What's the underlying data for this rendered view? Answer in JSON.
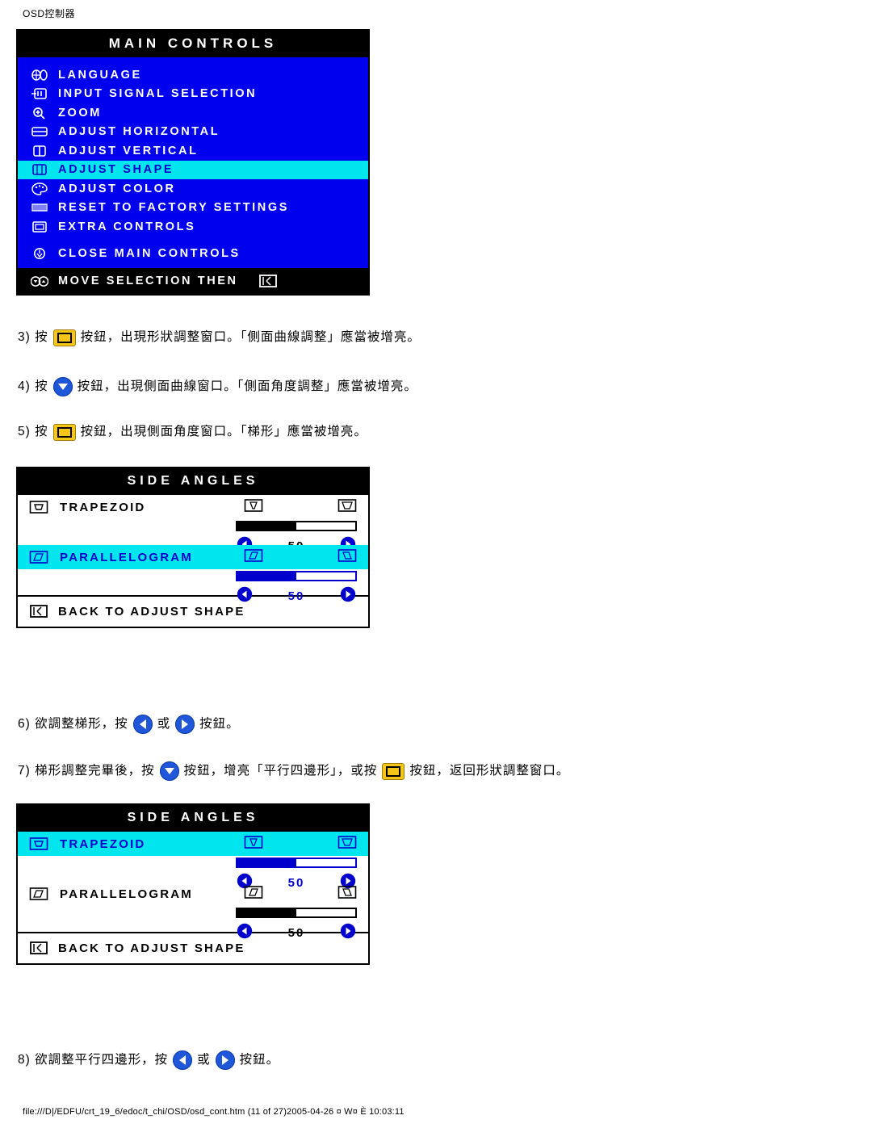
{
  "header": {
    "title": "OSD控制器"
  },
  "footer": {
    "text": "file:///D|/EDFU/crt_19_6/edoc/t_chi/OSD/osd_cont.htm (11 of 27)2005-04-26 ¤ W¤ È  10:03:11"
  },
  "main_controls": {
    "title": "MAIN CONTROLS",
    "items": [
      {
        "label": "LANGUAGE",
        "icon": "globe-icon",
        "highlighted": false
      },
      {
        "label": "INPUT SIGNAL SELECTION",
        "icon": "input-signal-icon",
        "highlighted": false
      },
      {
        "label": "ZOOM",
        "icon": "magnifier-icon",
        "highlighted": false
      },
      {
        "label": "ADJUST HORIZONTAL",
        "icon": "horizontal-icon",
        "highlighted": false
      },
      {
        "label": "ADJUST VERTICAL",
        "icon": "vertical-icon",
        "highlighted": false
      },
      {
        "label": "ADJUST SHAPE",
        "icon": "shape-icon",
        "highlighted": true
      },
      {
        "label": "ADJUST COLOR",
        "icon": "palette-icon",
        "highlighted": false
      },
      {
        "label": "RESET TO FACTORY SETTINGS",
        "icon": "reset-icon",
        "highlighted": false
      },
      {
        "label": "EXTRA CONTROLS",
        "icon": "extra-controls-icon",
        "highlighted": false
      },
      {
        "label": "CLOSE MAIN CONTROLS",
        "icon": "close-icon",
        "highlighted": false
      }
    ],
    "footer_label": "MOVE SELECTION THEN"
  },
  "side_angles_1": {
    "title": "SIDE ANGLES",
    "items": [
      {
        "label": "TRAPEZOID",
        "icon": "trapezoid-icon",
        "highlighted": false,
        "value": "50",
        "fill_percent": 50
      },
      {
        "label": "PARALLELOGRAM",
        "icon": "parallelogram-icon",
        "highlighted": true,
        "value": "50",
        "fill_percent": 50
      }
    ],
    "footer_label": "BACK TO ADJUST SHAPE"
  },
  "side_angles_2": {
    "title": "SIDE ANGLES",
    "items": [
      {
        "label": "TRAPEZOID",
        "icon": "trapezoid-icon",
        "highlighted": true,
        "value": "50",
        "fill_percent": 50
      },
      {
        "label": "PARALLELOGRAM",
        "icon": "parallelogram-icon",
        "highlighted": false,
        "value": "50",
        "fill_percent": 50
      }
    ],
    "footer_label": "BACK TO ADJUST SHAPE"
  },
  "steps": {
    "s3a": "3) 按",
    "s3b": "按鈕，出現形狀調整窗口。「側面曲線調整」應當被增亮。",
    "s4a": "4) 按",
    "s4b": "按鈕，出現側面曲線窗口。「側面角度調整」應當被增亮。",
    "s5a": "5) 按",
    "s5b": "按鈕，出現側面角度窗口。「梯形」應當被增亮。",
    "s6a": "6) 欲調整梯形，按",
    "s6b": "或",
    "s6c": "按鈕。",
    "s7a": "7) 梯形調整完畢後，按",
    "s7b": "按鈕，增亮「平行四邊形」，或按",
    "s7c": "按鈕，返回形狀調整窗口。",
    "s8a": "8) 欲調整平行四邊形，按",
    "s8b": "或",
    "s8c": "按鈕。"
  },
  "colors": {
    "osd_background": "#0000ee",
    "highlight": "#00e5ee",
    "highlight_text": "#0000cc",
    "title_bar": "#000000",
    "button_ok": "#f5c518",
    "button_arrow": "#1f57d8"
  }
}
